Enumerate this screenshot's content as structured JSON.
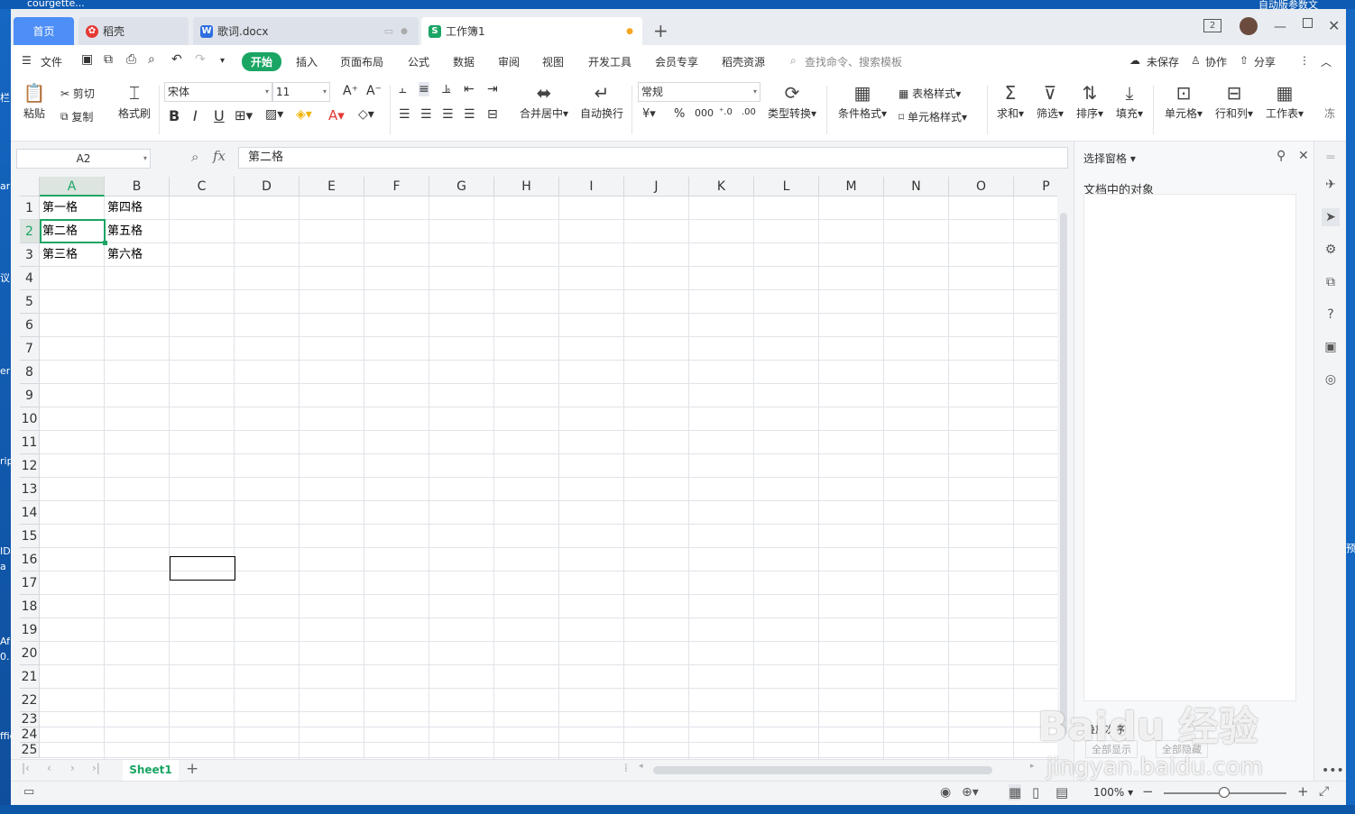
{
  "desktop": {
    "top_text": "courgette...",
    "top_right_text": "自动版参数文",
    "left_labels": [
      "栏",
      "ar",
      "议",
      "er",
      "rip",
      "ID",
      "a",
      "Af",
      "0.",
      "ffic"
    ],
    "right_label": "预"
  },
  "tabs": [
    {
      "label": "首页"
    },
    {
      "label": "稻壳",
      "icon": "daoke-icon"
    },
    {
      "label": "歌词.docx",
      "icon": "word-icon"
    },
    {
      "label": "工作簿1",
      "icon": "sheet-icon"
    }
  ],
  "window_controls": {
    "badge": "2"
  },
  "menu": {
    "file": "文件",
    "items": [
      "开始",
      "插入",
      "页面布局",
      "公式",
      "数据",
      "审阅",
      "视图",
      "开发工具",
      "会员专享",
      "稻壳资源"
    ],
    "search_placeholder": "查找命令、搜索模板",
    "unsaved": "未保存",
    "collab": "协作",
    "share": "分享"
  },
  "ribbon": {
    "paste": "粘贴",
    "cut": "剪切",
    "copy": "复制",
    "format_painter": "格式刷",
    "font": "宋体",
    "font_size": "11",
    "merge_center": "合并居中",
    "wrap": "自动换行",
    "number_format": "常规",
    "type_convert": "类型转换",
    "cond_format": "条件格式",
    "table_style": "表格样式",
    "cell_style": "单元格样式",
    "sum": "求和",
    "filter": "筛选",
    "sort": "排序",
    "fill": "填充",
    "cell": "单元格",
    "row_col": "行和列",
    "worksheet": "工作表",
    "more": "冻"
  },
  "formula_bar": {
    "name_box": "A2",
    "fx": "fx",
    "content": "第二格"
  },
  "columns": [
    "A",
    "B",
    "C",
    "D",
    "E",
    "F",
    "G",
    "H",
    "I",
    "J",
    "K",
    "L",
    "M",
    "N",
    "O",
    "P"
  ],
  "rows": [
    "1",
    "2",
    "3",
    "4",
    "5",
    "6",
    "7",
    "8",
    "9",
    "10",
    "11",
    "12",
    "13",
    "14",
    "15",
    "16",
    "17",
    "18",
    "19",
    "20",
    "21",
    "22",
    "23",
    "24",
    "25"
  ],
  "cells": {
    "A1": "第一格",
    "B1": "第四格",
    "A2": "第二格",
    "B2": "第五格",
    "A3": "第三格",
    "B3": "第六格"
  },
  "sheets": {
    "active": "Sheet1"
  },
  "panel": {
    "title": "选择窗格",
    "subtitle": "文档中的对象",
    "order_label": "叠放次序",
    "show_all": "全部显示",
    "hide_all": "全部隐藏"
  },
  "status": {
    "zoom": "100%"
  },
  "watermark": {
    "brand": "Baidu 经验",
    "url": "jingyan.baidu.com"
  }
}
